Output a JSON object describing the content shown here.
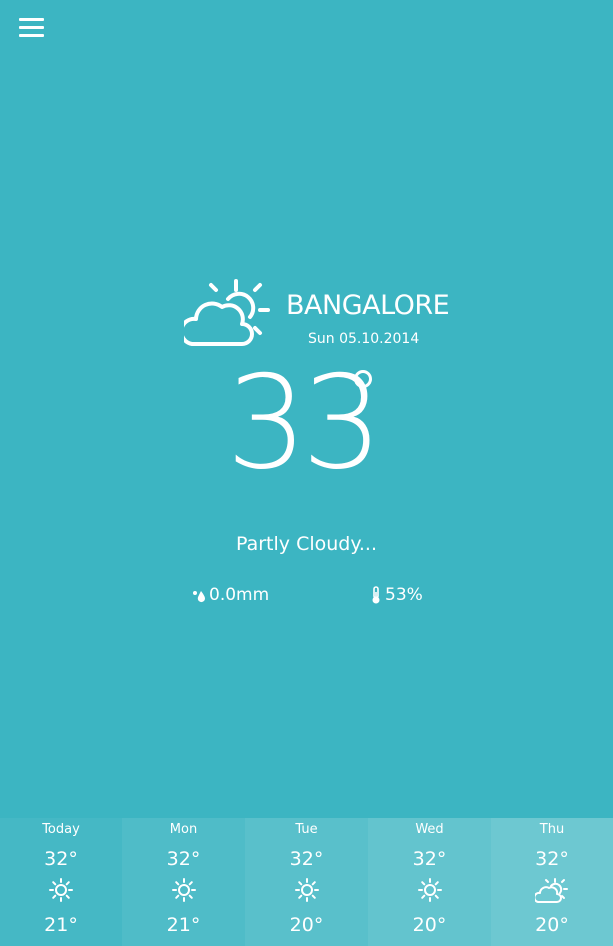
{
  "header": {
    "menu_icon": "hamburger-menu-icon"
  },
  "current": {
    "icon": "partly-cloudy-icon",
    "city": "BANGALORE",
    "date": "Sun 05.10.2014",
    "temperature": "33",
    "condition": "Partly Cloudy...",
    "precipitation": "0.0mm",
    "precipitation_icon": "raindrops-icon",
    "humidity": "53%",
    "humidity_icon": "thermometer-icon"
  },
  "forecast": [
    {
      "day": "Today",
      "high": "32°",
      "low": "21°",
      "icon": "sun-icon",
      "bg": "#45b8c5"
    },
    {
      "day": "Mon",
      "high": "32°",
      "low": "21°",
      "icon": "sun-icon",
      "bg": "#4fbcc8"
    },
    {
      "day": "Tue",
      "high": "32°",
      "low": "20°",
      "icon": "sun-icon",
      "bg": "#59c0cb"
    },
    {
      "day": "Wed",
      "high": "32°",
      "low": "20°",
      "icon": "sun-icon",
      "bg": "#63c4ce"
    },
    {
      "day": "Thu",
      "high": "32°",
      "low": "20°",
      "icon": "partly-cloudy-icon",
      "bg": "#6dc8d1"
    }
  ],
  "colors": {
    "background": "#3cb5c2",
    "text": "#ffffff"
  }
}
